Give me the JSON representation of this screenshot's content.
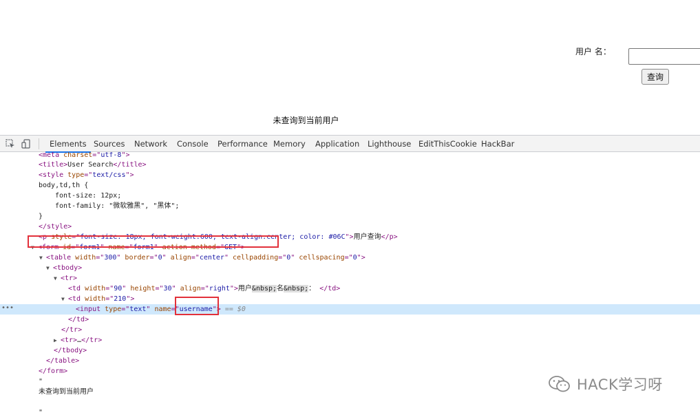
{
  "page": {
    "user_label": "用户 名：",
    "user_value": "",
    "query_button": "查询",
    "result_text": "未查询到当前用户"
  },
  "devtools": {
    "tabs": [
      "Elements",
      "Sources",
      "Network",
      "Console",
      "Performance",
      "Memory",
      "Application",
      "Lighthouse",
      "EditThisCookie",
      "HackBar"
    ],
    "active_tab": "Elements",
    "selected_suffix": "== $0",
    "lines": {
      "meta_charset": "utf-8",
      "title": "User Search",
      "style_type": "text/css",
      "css_selector": "body,td,th {",
      "css_font_size": "font-size: 12px;",
      "css_font_family": "font-family: \"微软雅黑\", \"黑体\";",
      "css_close": "}",
      "p_style": "font-size: 18px; font-weight:600; text-align:center; color: #06C",
      "p_text": "用户查询",
      "form_id": "form1",
      "form_name": "form1",
      "form_method": "GET",
      "table_width": "300",
      "table_border": "0",
      "table_align": "center",
      "table_cellpadding": "0",
      "table_cellspacing": "0",
      "td1_width": "90",
      "td1_height": "30",
      "td1_align": "right",
      "td1_text_a": "用户",
      "td1_ent1": "&nbsp;",
      "td1_text_b": "名",
      "td1_ent2": "&nbsp;",
      "td1_text_c": "：",
      "td2_width": "210",
      "input_type": "text",
      "input_name": "username",
      "tr_collapsed": "…",
      "text_node_quote": "\"",
      "text_node_result": "未查询到当前用户",
      "text_node_quote_end": "\""
    }
  },
  "watermark": "HACK学习呀"
}
